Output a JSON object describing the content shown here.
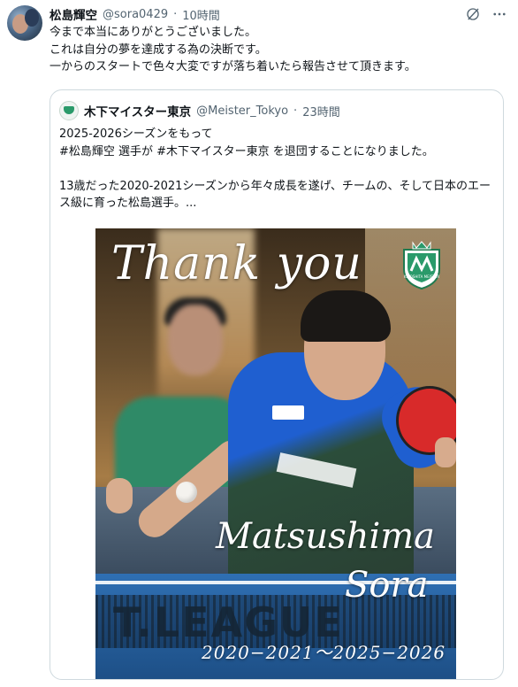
{
  "tweet": {
    "author_name": "松島輝空",
    "handle": "@sora0429",
    "separator": "·",
    "time": "10時間",
    "text": "今まで本当にありがとうございました。\nこれは自分の夢を達成する為の決断です。\n一からのスタートで色々大変ですが落ち着いたら報告させて頂きます。"
  },
  "quoted": {
    "author_name": "木下マイスター東京",
    "handle": "@Meister_Tokyo",
    "separator": "·",
    "time": "23時間",
    "text": "2025-2026シーズンをもって\n#松島輝空 選手が #木下マイスター東京 を退団することになりました。\n\n13歳だった2020-2021シーズンから年々成長を遂げ、チームの、そして日本のエース級に育った松島選手。..."
  },
  "image": {
    "thank_you": "Thank you",
    "name_first": "Matsushima",
    "name_last": "Sora",
    "years": "2020−2021〜2025−2026",
    "banner": "T.LEAGUE",
    "badge_text": "KINOSHITA MEISTER"
  },
  "icons": {
    "grok": "grok-icon",
    "more": "more-options-icon",
    "team_logo": "team-logo-icon"
  },
  "colors": {
    "text": "#0f1419",
    "secondary": "#536471",
    "border": "#cfd9de",
    "team_green": "#2a9a6a"
  }
}
